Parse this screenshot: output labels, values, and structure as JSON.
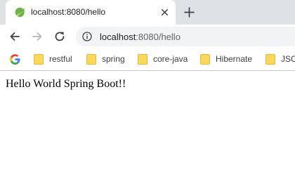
{
  "tab": {
    "title": "localhost:8080/hello",
    "favicon": "spring-leaf-icon",
    "favicon_color": "#6db33f"
  },
  "toolbar": {
    "url_host": "localhost",
    "url_rest": ":8080/hello"
  },
  "bookmarks": {
    "google_icon": "google-icon",
    "items": [
      {
        "label": "restful"
      },
      {
        "label": "spring"
      },
      {
        "label": "core-java"
      },
      {
        "label": "Hibernate"
      },
      {
        "label": "JSON"
      }
    ],
    "folder_color": "#fbd75b"
  },
  "page": {
    "message": "Hello World Spring Boot!!"
  },
  "colors": {
    "tabstrip_bg": "#dee1e6",
    "omnibox_bg": "#f1f3f4"
  }
}
